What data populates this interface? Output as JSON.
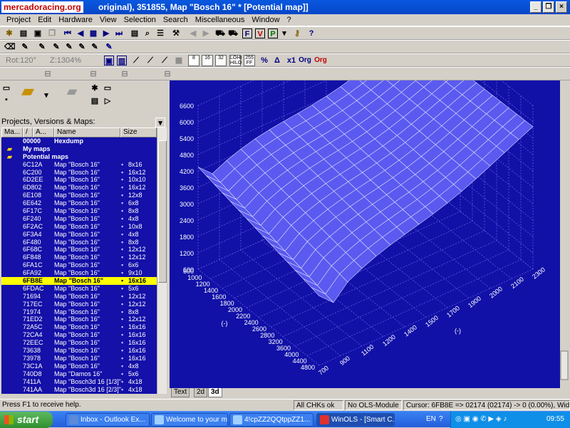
{
  "window": {
    "title": "original), 351855, Map \"Bosch 16\" *  [Potential map]]",
    "watermark": "mercadoracing.org",
    "controls": [
      "_",
      "❐",
      "×"
    ]
  },
  "menu": [
    "Project",
    "Edit",
    "Hardware",
    "View",
    "Selection",
    "Search",
    "Miscellaneous",
    "Window",
    "?"
  ],
  "toolbar": {
    "rot_label": "Rot:120°",
    "z_label": "Z:1304%",
    "mini_buttons": [
      {
        "top": "8",
        "bottom": ""
      },
      {
        "top": "16",
        "bottom": ""
      },
      {
        "top": "32",
        "bottom": ""
      },
      {
        "top": "LOHI",
        "bottom": "HILO"
      },
      {
        "top": "255",
        "bottom": "FF"
      }
    ],
    "sym_x1": "x1",
    "sym_org": "Org",
    "sym_org2": "Org"
  },
  "left_panel": {
    "label": "Projects, Versions & Maps:",
    "columns": [
      "Ma...",
      "/",
      "A...",
      "Name",
      "Size"
    ],
    "rows": [
      {
        "addr": "00000",
        "name": "Hexdump",
        "size": "",
        "type": "hdr"
      },
      {
        "addr": "",
        "name": "My maps",
        "size": "",
        "type": "folder"
      },
      {
        "addr": "",
        "name": "Potential maps",
        "size": "",
        "type": "folder"
      },
      {
        "addr": "6C12A",
        "name": "Map \"Bosch 16\"",
        "size": "8x16"
      },
      {
        "addr": "6C200",
        "name": "Map \"Bosch 16\"",
        "size": "16x12"
      },
      {
        "addr": "6D2EE",
        "name": "Map \"Bosch 16\"",
        "size": "10x10"
      },
      {
        "addr": "6D802",
        "name": "Map \"Bosch 16\"",
        "size": "16x12"
      },
      {
        "addr": "6E108",
        "name": "Map \"Bosch 16\"",
        "size": "12x8"
      },
      {
        "addr": "6E642",
        "name": "Map \"Bosch 16\"",
        "size": "6x8"
      },
      {
        "addr": "6F17C",
        "name": "Map \"Bosch 16\"",
        "size": "8x8"
      },
      {
        "addr": "6F240",
        "name": "Map \"Bosch 16\"",
        "size": "4x8"
      },
      {
        "addr": "6F2AC",
        "name": "Map \"Bosch 16\"",
        "size": "10x8"
      },
      {
        "addr": "6F3A4",
        "name": "Map \"Bosch 16\"",
        "size": "4x8"
      },
      {
        "addr": "6F480",
        "name": "Map \"Bosch 16\"",
        "size": "8x8"
      },
      {
        "addr": "6F68C",
        "name": "Map \"Bosch 16\"",
        "size": "12x12"
      },
      {
        "addr": "6F848",
        "name": "Map \"Bosch 16\"",
        "size": "12x12"
      },
      {
        "addr": "6FA1C",
        "name": "Map \"Bosch 16\"",
        "size": "6x6"
      },
      {
        "addr": "6FA92",
        "name": "Map \"Bosch 16\"",
        "size": "9x10"
      },
      {
        "addr": "6FB8E",
        "name": "Map \"Bosch 16\"",
        "size": "16x16",
        "type": "sel"
      },
      {
        "addr": "6FDAC",
        "name": "Map \"Bosch 16\"",
        "size": "5x6"
      },
      {
        "addr": "71694",
        "name": "Map \"Bosch 16\"",
        "size": "12x12"
      },
      {
        "addr": "717EC",
        "name": "Map \"Bosch 16\"",
        "size": "12x12"
      },
      {
        "addr": "71974",
        "name": "Map \"Bosch 16\"",
        "size": "8x8"
      },
      {
        "addr": "71ED2",
        "name": "Map \"Bosch 16\"",
        "size": "12x12"
      },
      {
        "addr": "72A5C",
        "name": "Map \"Bosch 16\"",
        "size": "16x16"
      },
      {
        "addr": "72CA4",
        "name": "Map \"Bosch 16\"",
        "size": "16x16"
      },
      {
        "addr": "72EEC",
        "name": "Map \"Bosch 16\"",
        "size": "16x16"
      },
      {
        "addr": "73638",
        "name": "Map \"Bosch 16\"",
        "size": "16x16"
      },
      {
        "addr": "73978",
        "name": "Map \"Bosch 16\"",
        "size": "16x16"
      },
      {
        "addr": "73C1A",
        "name": "Map \"Bosch 16\"",
        "size": "4x8"
      },
      {
        "addr": "740D8",
        "name": "Map \"Damos 16\"",
        "size": "5x6"
      },
      {
        "addr": "7411A",
        "name": "Map \"Bosch3d 16 [1/3]\"",
        "size": "4x18"
      },
      {
        "addr": "741AA",
        "name": "Map \"Bosch3d 16 [2/3]\"",
        "size": "4x18"
      }
    ]
  },
  "plot": {
    "z_ticks": [
      "6600",
      "6000",
      "5400",
      "4800",
      "4200",
      "3600",
      "3000",
      "2400",
      "1800",
      "1200",
      "600"
    ],
    "left_ticks": [
      "600",
      "1000",
      "1200",
      "1400",
      "1600",
      "1800",
      "2000",
      "2200",
      "2400",
      "2600",
      "2800",
      "3200",
      "3600",
      "4000",
      "4400",
      "4800"
    ],
    "left_unit": "(-)",
    "bottom_ticks": [
      "700",
      "900",
      "1100",
      "1300",
      "1500",
      "1700",
      "1900",
      "2100",
      "2300"
    ],
    "bottom_extra": [
      "1200",
      "1500",
      "1700",
      "2000",
      "2200"
    ],
    "bottom_unit": "(-)",
    "bottom_row": [
      "700",
      "900",
      "1100",
      "1200",
      "1400",
      "1500",
      "1700",
      "1900",
      "2000",
      "2100",
      "2300"
    ]
  },
  "tabs": [
    "Text",
    "2d",
    "3d"
  ],
  "status": {
    "help": "Press F1 to receive help.",
    "chks": "All CHKs ok",
    "module": "No OLS-Module",
    "cursor": "Cursor: 6FB8E => 02174 (02174) -> 0 (0.00%), Width: 16"
  },
  "taskbar": {
    "start": "start",
    "tasks": [
      "Inbox - Outlook Ex...",
      "Welcome to your m...",
      "4!cpZZ2QQtppZZ1...",
      "WinOLS - [Smart C..."
    ],
    "lang": "EN",
    "clock": "09:55"
  },
  "colors": {
    "plot_bg": "#1111a8",
    "surface": "#5a5af0",
    "selected_row": "#ffff00"
  }
}
